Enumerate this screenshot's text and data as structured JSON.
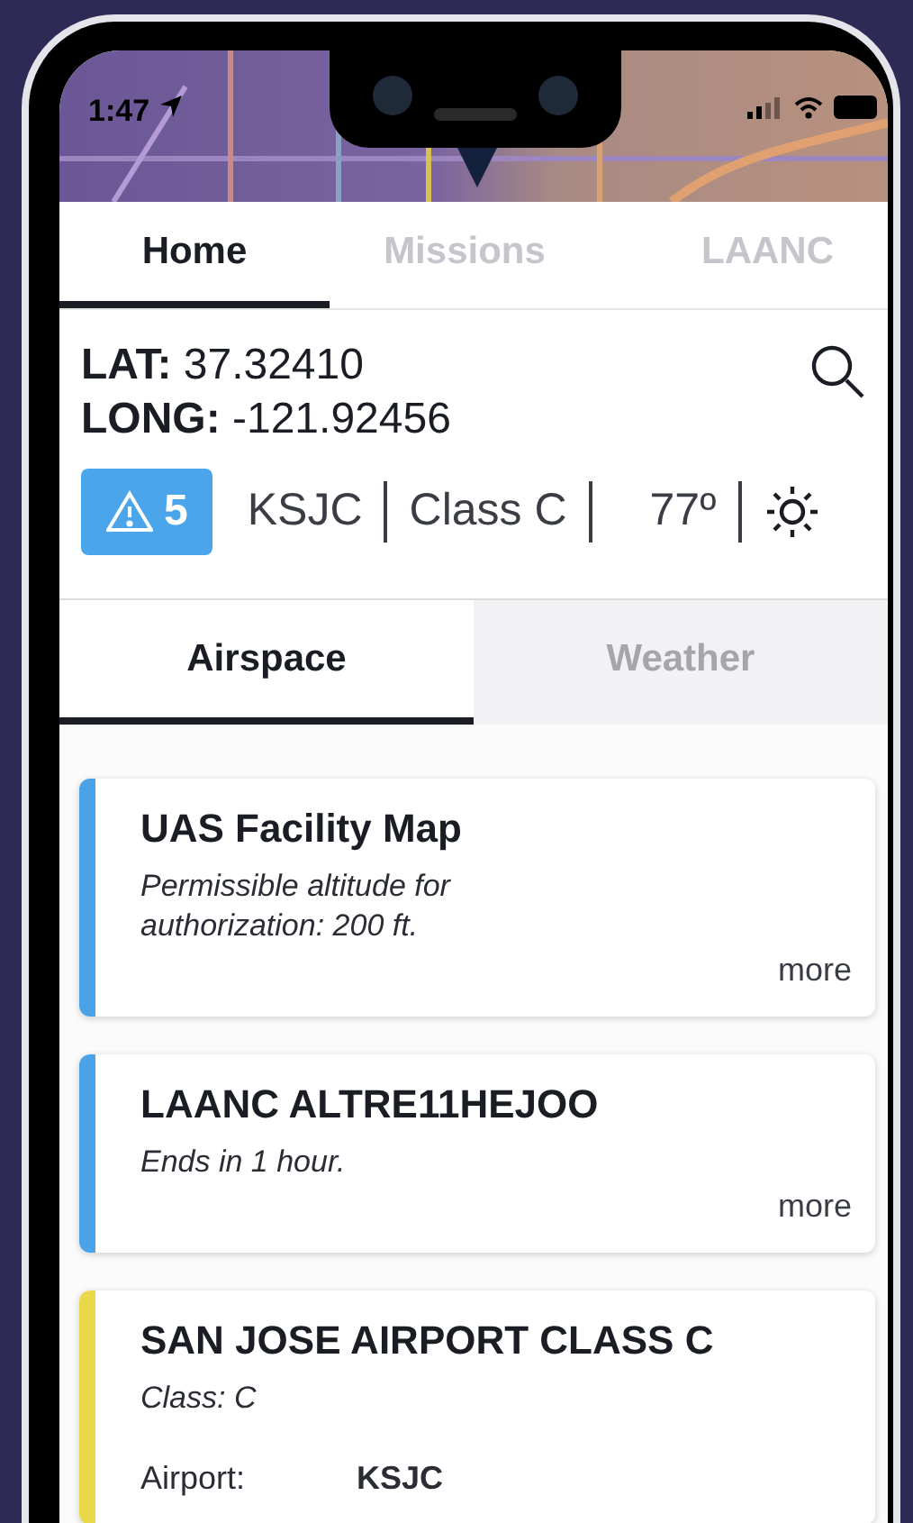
{
  "status_bar": {
    "time": "1:47"
  },
  "tabs": [
    {
      "label": "Home",
      "selected": true
    },
    {
      "label": "Missions",
      "selected": false
    },
    {
      "label": "LAANC",
      "selected": false
    }
  ],
  "location": {
    "lat_label": "LAT:",
    "lat": "37.32410",
    "long_label": "LONG:",
    "long": "-121.92456"
  },
  "summary": {
    "alerts": "5",
    "airport": "KSJC",
    "airspace_class": "Class C",
    "temperature": "77º"
  },
  "subtabs": [
    {
      "label": "Airspace",
      "selected": true
    },
    {
      "label": "Weather",
      "selected": false
    }
  ],
  "cards": [
    {
      "title": "UAS Facility Map",
      "subtitle": "Permissible altitude for authorization: 200 ft.",
      "color": "#4aa3e8",
      "link": "more"
    },
    {
      "title": "LAANC ALTRE11HEJOO",
      "subtitle": "Ends in 1 hour.",
      "color": "#4aa3e8",
      "link": "more"
    },
    {
      "title": "SAN JOSE AIRPORT CLASS C",
      "subtitle": "Class: C",
      "color": "#e8d84a",
      "fields": [
        {
          "label": "Airport:",
          "value": "KSJC"
        }
      ]
    }
  ]
}
